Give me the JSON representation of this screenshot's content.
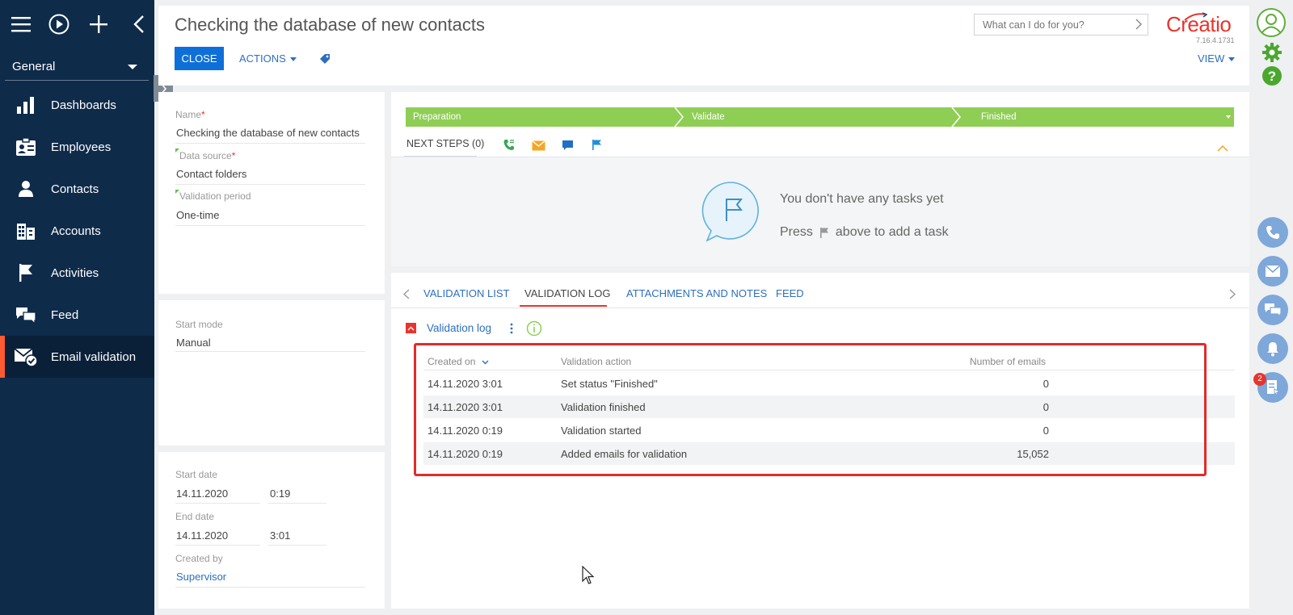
{
  "sidebar": {
    "workplace": "General",
    "items": [
      {
        "label": "Dashboards",
        "icon": "dashboards-icon"
      },
      {
        "label": "Employees",
        "icon": "employees-icon"
      },
      {
        "label": "Contacts",
        "icon": "contacts-icon"
      },
      {
        "label": "Accounts",
        "icon": "accounts-icon"
      },
      {
        "label": "Activities",
        "icon": "activities-icon"
      },
      {
        "label": "Feed",
        "icon": "feed-icon"
      },
      {
        "label": "Email validation",
        "icon": "email-validation-icon"
      }
    ],
    "active_index": 6
  },
  "header": {
    "title": "Checking the database of new contacts",
    "close_label": "CLOSE",
    "actions_label": "ACTIONS",
    "search_placeholder": "What can I do for you?",
    "logo": "Creatio",
    "version": "7.16.4.1731",
    "view_label": "VIEW"
  },
  "left_panel": {
    "name_label": "Name",
    "name_value": "Checking the database of new contacts",
    "source_label": "Data source",
    "source_value": "Contact folders",
    "period_label": "Validation period",
    "period_value": "One-time",
    "start_mode_label": "Start mode",
    "start_mode_value": "Manual",
    "start_date_label": "Start date",
    "start_date": "14.11.2020",
    "start_time": "0:19",
    "end_date_label": "End date",
    "end_date": "14.11.2020",
    "end_time": "3:01",
    "created_by_label": "Created by",
    "created_by": "Supervisor"
  },
  "stages": [
    "Preparation",
    "Validate",
    "Finished"
  ],
  "next_steps": {
    "label": "NEXT STEPS (0)",
    "empty_title": "You don't have any tasks yet",
    "empty_hint_before": "Press",
    "empty_hint_after": "above to add a task"
  },
  "tabs": [
    "VALIDATION LIST",
    "VALIDATION LOG",
    "ATTACHMENTS AND NOTES",
    "FEED"
  ],
  "active_tab": 1,
  "log": {
    "title": "Validation log",
    "columns": [
      "Created on",
      "Validation action",
      "Number of emails"
    ],
    "rows": [
      {
        "created": "14.11.2020 3:01",
        "action": "Set status \"Finished\"",
        "count": "0"
      },
      {
        "created": "14.11.2020 3:01",
        "action": "Validation finished",
        "count": "0"
      },
      {
        "created": "14.11.2020 0:19",
        "action": "Validation started",
        "count": "0"
      },
      {
        "created": "14.11.2020 0:19",
        "action": "Added emails for validation",
        "count": "15,052"
      }
    ]
  },
  "notifications_badge": "2",
  "colors": {
    "sidebar": "#0f2b4a",
    "accent": "#0f6fd9",
    "stage_green": "#8fce55",
    "highlight_red": "#e02b2b"
  }
}
